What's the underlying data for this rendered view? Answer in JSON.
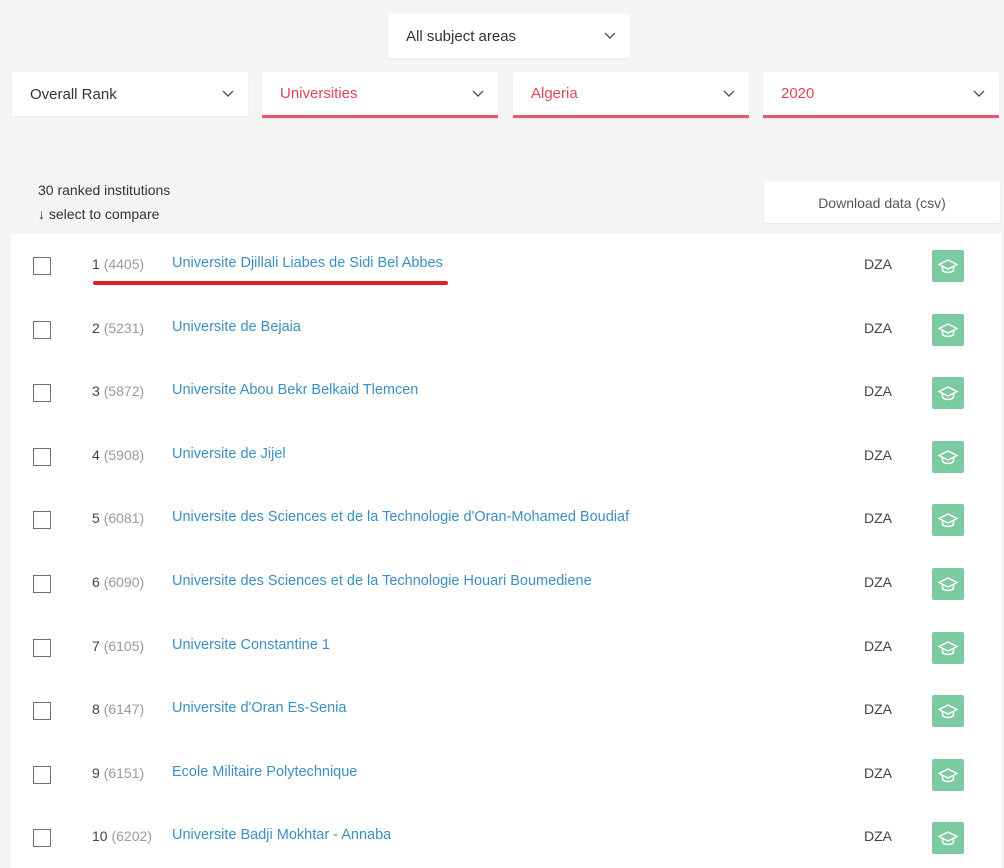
{
  "filters": {
    "subject": "All subject areas",
    "rank": "Overall Rank",
    "type": "Universities",
    "country": "Algeria",
    "year": "2020"
  },
  "summary": {
    "count_text": "30 ranked institutions",
    "compare_text": "↓ select to compare"
  },
  "download_label": "Download data (csv)",
  "colors": {
    "accent": "#e0455a",
    "link": "#3b8fc4",
    "badge": "#7ccaa0"
  },
  "rows": [
    {
      "rank": "1",
      "score": "(4405)",
      "name": "Universite Djillali Liabes de Sidi Bel Abbes",
      "code": "DZA"
    },
    {
      "rank": "2",
      "score": "(5231)",
      "name": "Universite de Bejaia",
      "code": "DZA"
    },
    {
      "rank": "3",
      "score": "(5872)",
      "name": "Universite Abou Bekr Belkaid Tlemcen",
      "code": "DZA"
    },
    {
      "rank": "4",
      "score": "(5908)",
      "name": "Universite de Jijel",
      "code": "DZA"
    },
    {
      "rank": "5",
      "score": "(6081)",
      "name": "Universite des Sciences et de la Technologie d'Oran-Mohamed Boudiaf",
      "code": "DZA"
    },
    {
      "rank": "6",
      "score": "(6090)",
      "name": "Universite des Sciences et de la Technologie Houari Boumediene",
      "code": "DZA"
    },
    {
      "rank": "7",
      "score": "(6105)",
      "name": "Universite Constantine 1",
      "code": "DZA"
    },
    {
      "rank": "8",
      "score": "(6147)",
      "name": "Universite d'Oran Es-Senia",
      "code": "DZA"
    },
    {
      "rank": "9",
      "score": "(6151)",
      "name": "Ecole Militaire Polytechnique",
      "code": "DZA"
    },
    {
      "rank": "10",
      "score": "(6202)",
      "name": "Universite Badji Mokhtar - Annaba",
      "code": "DZA"
    }
  ]
}
